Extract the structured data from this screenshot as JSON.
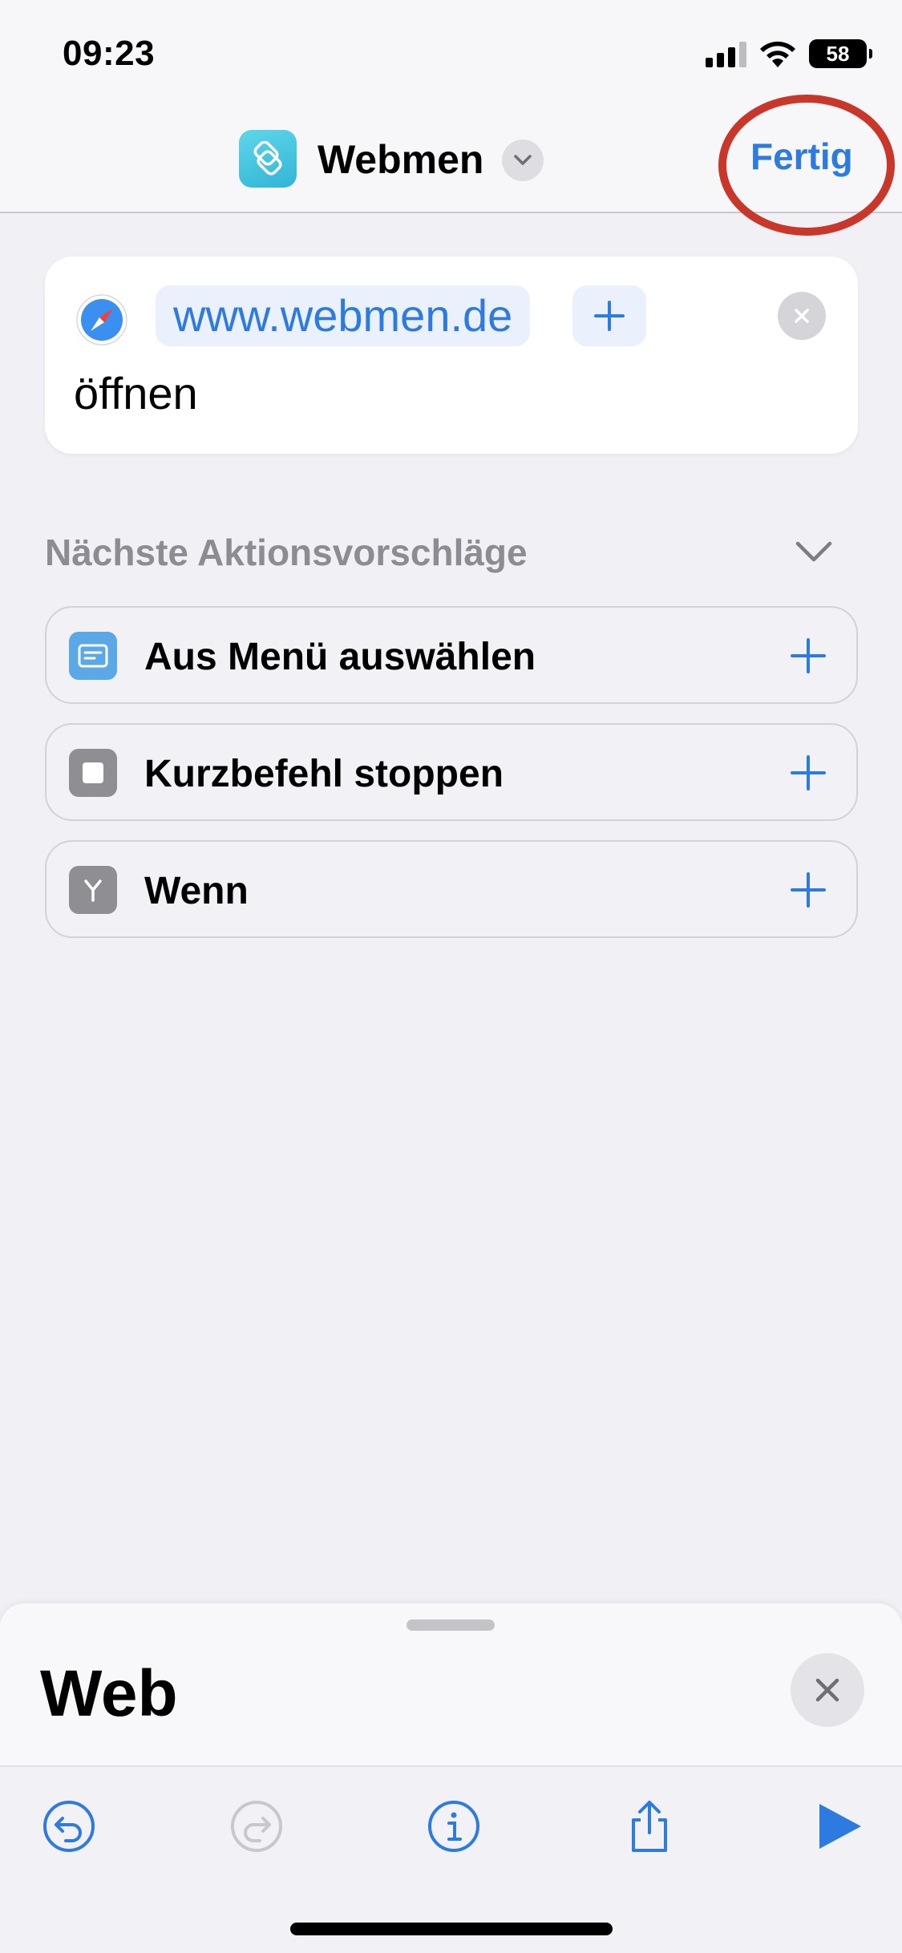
{
  "status_bar": {
    "time": "09:23",
    "battery": "58"
  },
  "nav": {
    "title": "Webmen",
    "done_label": "Fertig"
  },
  "action": {
    "url": "www.webmen.de",
    "verb": "öffnen"
  },
  "suggestions": {
    "header": "Nächste Aktionsvorschläge",
    "items": [
      {
        "label": "Aus Menü auswählen",
        "icon": "menu-list-icon",
        "color": "#5aa8e6"
      },
      {
        "label": "Kurzbefehl stoppen",
        "icon": "stop-icon",
        "color": "#8e8e93"
      },
      {
        "label": "Wenn",
        "icon": "branch-icon",
        "color": "#8e8e93"
      }
    ]
  },
  "sheet": {
    "title": "Web"
  },
  "colors": {
    "accent": "#2d7be0",
    "annotation": "#c9372b"
  }
}
